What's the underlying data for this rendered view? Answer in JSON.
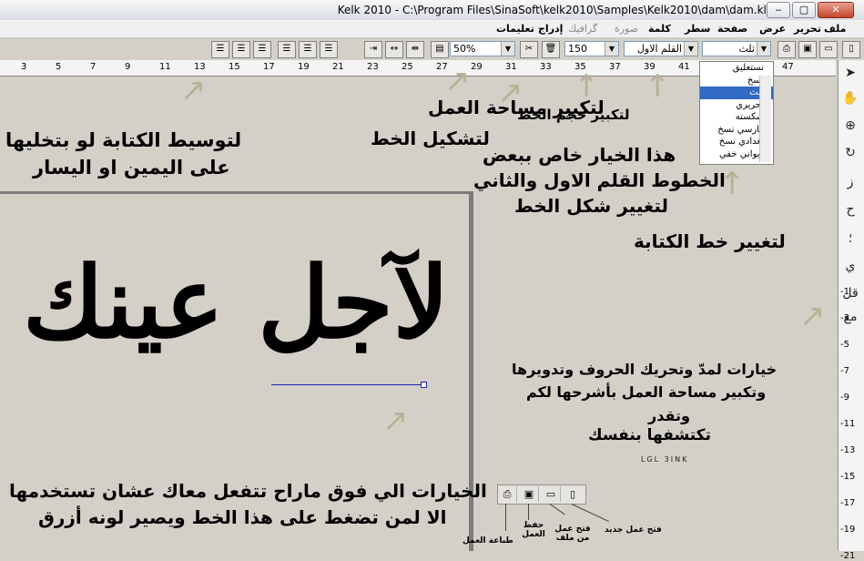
{
  "window": {
    "title": "Kelk 2010 - C:\\Program Files\\SinaSoft\\kelk2010\\Samples\\Kelk2010\\dam\\dam.klx",
    "minimize": "‒",
    "maximize": "▢",
    "close": "✕"
  },
  "menu": [
    {
      "label": "ملف",
      "dim": false
    },
    {
      "label": "تحرير",
      "dim": false
    },
    {
      "label": "عرض",
      "dim": false
    },
    {
      "label": "صفحة",
      "dim": false
    },
    {
      "label": "سطر",
      "dim": false
    },
    {
      "label": "كلمة",
      "dim": false
    },
    {
      "label": "صورة",
      "dim": true
    },
    {
      "label": "گرافيك",
      "dim": true
    },
    {
      "label": "إدراج",
      "dim": false
    },
    {
      "label": "تعليمات",
      "dim": false
    }
  ],
  "toolbar": {
    "zoom_value": "50%",
    "size_value": "150",
    "pen_value": "القلم الاول",
    "font_value": "ثلث"
  },
  "ruler_ticks": [
    "3",
    "5",
    "7",
    "9",
    "11",
    "13",
    "15",
    "17",
    "19",
    "21",
    "23",
    "25",
    "27",
    "29",
    "31",
    "33",
    "35",
    "37",
    "39",
    "41",
    "43",
    "45",
    "47"
  ],
  "vruler_ticks": [
    "-1",
    "-3",
    "-5",
    "-7",
    "-9",
    "-11",
    "-13",
    "-15",
    "-17",
    "-19",
    "-21"
  ],
  "font_list": {
    "items": [
      "نستعليق",
      "نسخ",
      "ثلث",
      "تحريري",
      "شكسته",
      "فارسي نسخ",
      "بغدادي نسخ",
      "ديواني خفي"
    ],
    "selected_index": 2
  },
  "canvas": {
    "main_word": "لآجل عينك"
  },
  "annotations": {
    "work_area": "لتكبير مساحة العمل",
    "font_size": "لتكبير حجم الخط",
    "shape": "لتشكيل الخط",
    "center_line1": "لتوسيط الكتابة لو بتخليها",
    "center_line2": "على اليمين او اليسار",
    "pen_line1": "هذا الخيار خاص ببعض",
    "pen_line2": "الخطوط القلم الاول والثاني",
    "pen_line3": "لتغيير شكل الخط",
    "change_font": "لتغيير خط الكتابة",
    "tools_line1": "خيارات لمدّ وتحريك الحروف وتدويرها",
    "tools_line2": "وتكبير مساحة العمل بأشرحها لكم",
    "tools_line3": "وتقدر",
    "tools_line4": "تكتشفها بنفسك",
    "bottom_line1": "الخيارات الي فوق ماراح تتفعل معاك عشان تستخدمها",
    "bottom_line2": "الا لمن تضغط على هذا الخط ويصير لونه أزرق",
    "signature": "LGL 3INK"
  },
  "mini_toolbar": {
    "print_label": "طباعة العمل",
    "save_label": "حفظ العمل",
    "open_label": "فتح عمل من ملف",
    "new_label": "فتح عمل جديد"
  },
  "colors": {
    "selection": "#316ac5",
    "arrow": "#b8b296",
    "baseline": "#1b25b8"
  }
}
